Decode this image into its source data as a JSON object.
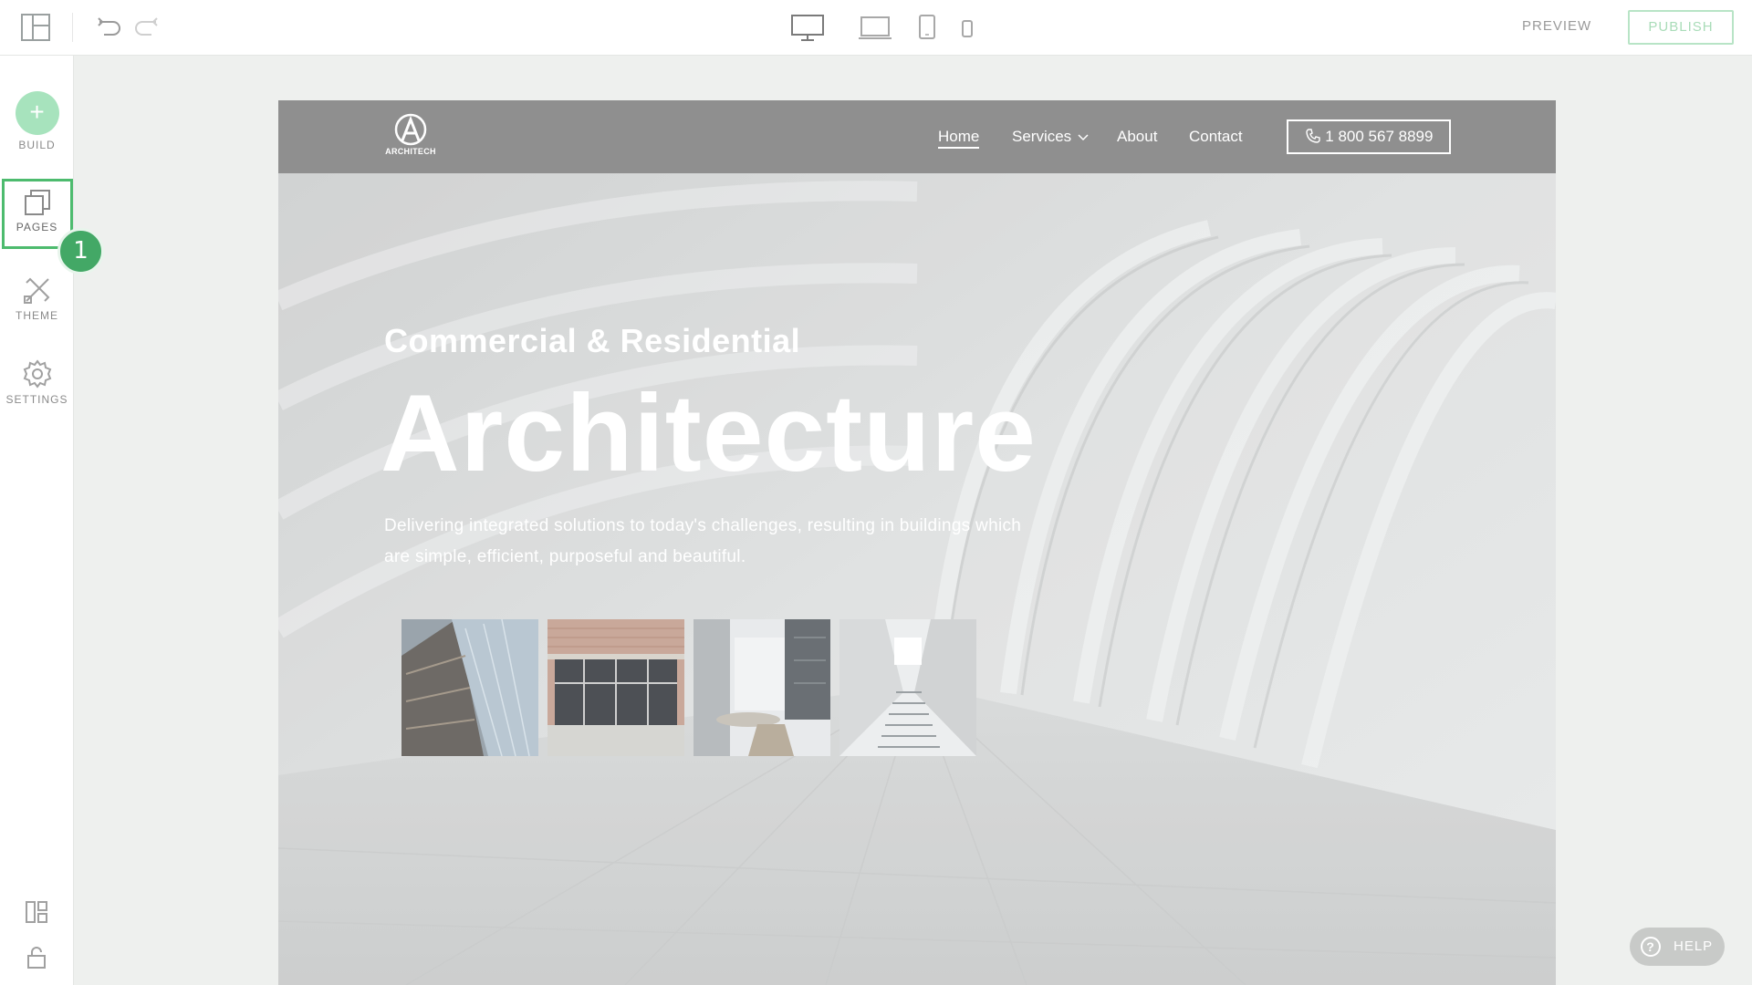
{
  "toolbar": {
    "preview_label": "PREVIEW",
    "publish_label": "PUBLISH",
    "devices": [
      "desktop",
      "laptop",
      "tablet",
      "mobile"
    ]
  },
  "sidebar": {
    "items": [
      {
        "label": "BUILD",
        "icon": "plus-icon"
      },
      {
        "label": "PAGES",
        "icon": "pages-icon"
      },
      {
        "label": "THEME",
        "icon": "theme-icon"
      },
      {
        "label": "SETTINGS",
        "icon": "gear-icon"
      }
    ],
    "highlight_step": "1"
  },
  "site": {
    "logo_text": "ARCHITECH",
    "nav": {
      "home": "Home",
      "services": "Services",
      "about": "About",
      "contact": "Contact",
      "phone": "1 800 567 8899"
    },
    "hero": {
      "subtitle": "Commercial & Residential",
      "title": "Architecture",
      "description": "Delivering integrated solutions to today's challenges, resulting in buildings which are simple, efficient, purposeful and beautiful."
    }
  },
  "help": {
    "label": "HELP"
  },
  "colors": {
    "accent_green": "#4dbb6e",
    "build_green": "#a7e3bd",
    "nav_gray": "#8f8f8f"
  }
}
